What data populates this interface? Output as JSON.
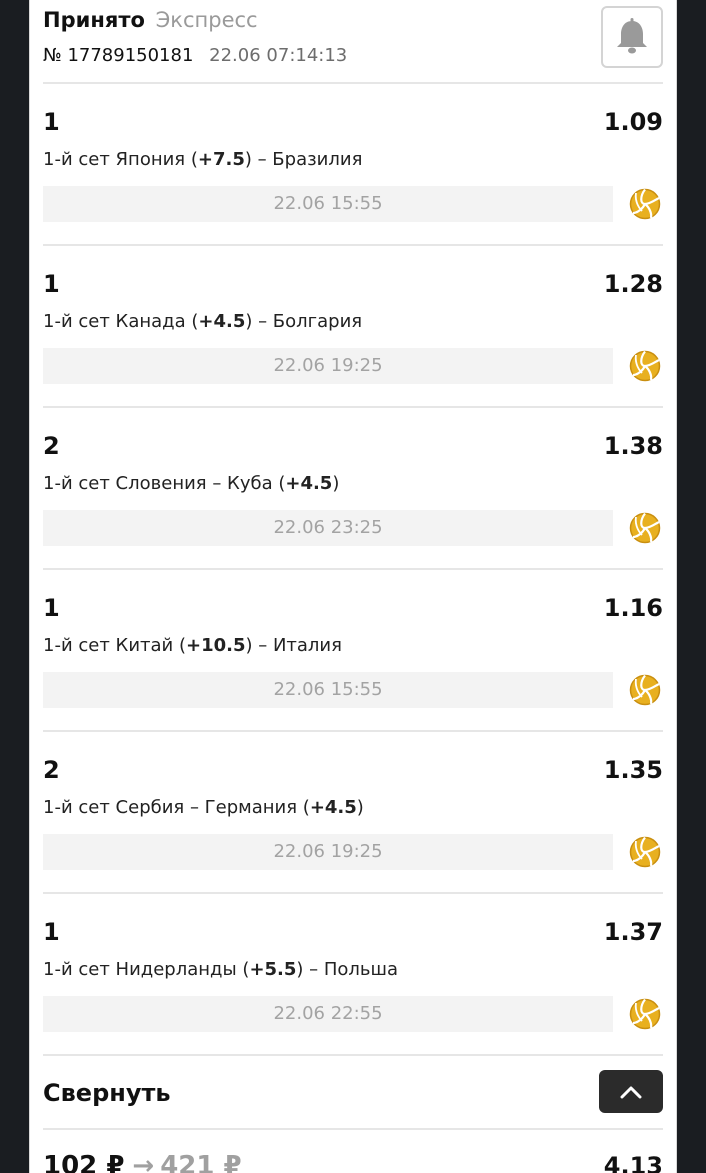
{
  "header": {
    "status": "Принято",
    "bet_type": "Экспресс",
    "bet_number": "№ 17789150181",
    "bet_datetime": "22.06 07:14:13"
  },
  "selections": [
    {
      "outcome": "1",
      "odds": "1.09",
      "market_prefix": "1-й сет Япония (",
      "handicap": "+7.5",
      "market_suffix": ") – Бразилия",
      "time": "22.06 15:55",
      "sport_icon": "volleyball-icon"
    },
    {
      "outcome": "1",
      "odds": "1.28",
      "market_prefix": "1-й сет Канада (",
      "handicap": "+4.5",
      "market_suffix": ") – Болгария",
      "time": "22.06 19:25",
      "sport_icon": "volleyball-icon"
    },
    {
      "outcome": "2",
      "odds": "1.38",
      "market_prefix": "1-й сет Словения – Куба (",
      "handicap": "+4.5",
      "market_suffix": ")",
      "time": "22.06 23:25",
      "sport_icon": "volleyball-icon"
    },
    {
      "outcome": "1",
      "odds": "1.16",
      "market_prefix": "1-й сет Китай (",
      "handicap": "+10.5",
      "market_suffix": ") – Италия",
      "time": "22.06 15:55",
      "sport_icon": "volleyball-icon"
    },
    {
      "outcome": "2",
      "odds": "1.35",
      "market_prefix": "1-й сет Сербия – Германия (",
      "handicap": "+4.5",
      "market_suffix": ")",
      "time": "22.06 19:25",
      "sport_icon": "volleyball-icon"
    },
    {
      "outcome": "1",
      "odds": "1.37",
      "market_prefix": "1-й сет Нидерланды (",
      "handicap": "+5.5",
      "market_suffix": ") – Польша",
      "time": "22.06 22:55",
      "sport_icon": "volleyball-icon"
    }
  ],
  "collapse": {
    "label": "Свернуть",
    "icon": "chevron-up-icon"
  },
  "summary": {
    "stake": "102 ₽",
    "arrow": "→",
    "payout": "421 ₽",
    "total_odds": "4.13"
  },
  "colors": {
    "accent_icon": "#e8b020",
    "dark_button": "#2b2b2b",
    "muted_text": "#9a9a9a"
  }
}
